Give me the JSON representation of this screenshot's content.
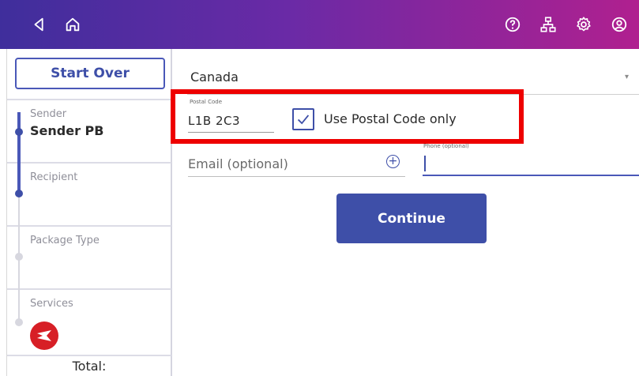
{
  "topbar": {
    "icons_left": [
      "back-icon",
      "home-icon"
    ],
    "icons_right": [
      "help-icon",
      "network-icon",
      "settings-icon",
      "account-icon"
    ],
    "gradient_colors": [
      "#3f2e9c",
      "#6a2aa6",
      "#b0208f"
    ]
  },
  "sidebar": {
    "start_over_label": "Start Over",
    "steps": [
      {
        "label": "Sender",
        "value": "Sender PB"
      },
      {
        "label": "Recipient",
        "value": ""
      },
      {
        "label": "Package Type",
        "value": ""
      },
      {
        "label": "Services",
        "icon": "canada-post-icon"
      }
    ],
    "total_label": "Total:"
  },
  "form": {
    "country_value": "Canada",
    "postal_code_label": "Postal Code",
    "postal_code_value": "L1B 2C3",
    "use_postal_only_label": "Use Postal Code only",
    "use_postal_only_checked": true,
    "email_placeholder": "Email (optional)",
    "phone_label": "Phone (optional)",
    "continue_label": "Continue"
  },
  "colors": {
    "accent": "#3e4fa8",
    "highlight": "#ee0000",
    "canada_post_red": "#d71f26"
  }
}
